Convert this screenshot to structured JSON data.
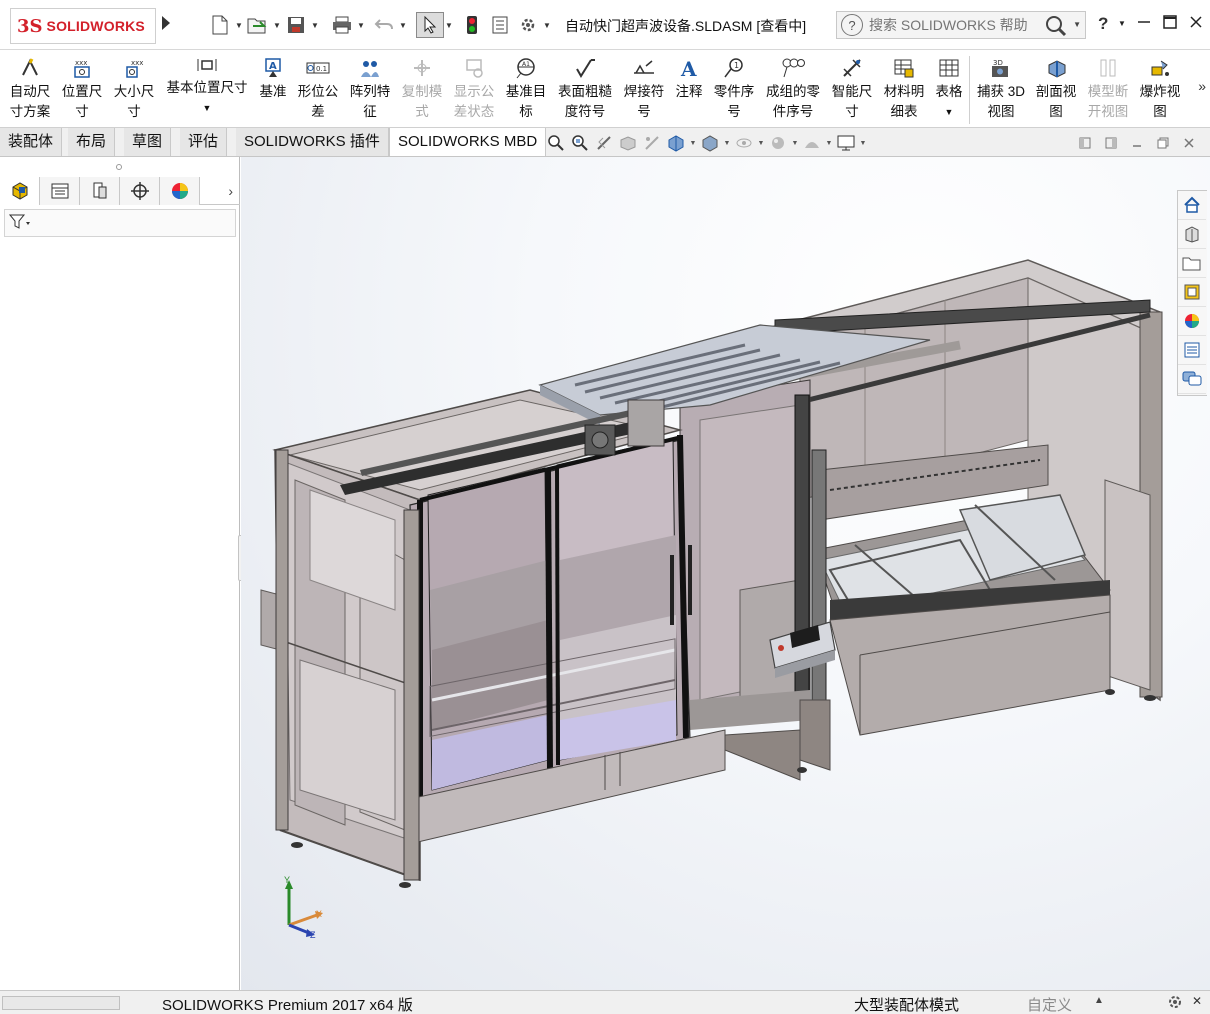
{
  "app": {
    "logo_ds": "3S",
    "logo_text": "SOLIDWORKS",
    "document_title": "自动快门超声波设备.SLDASM [查看中]"
  },
  "search": {
    "placeholder": "搜索 SOLIDWORKS 帮助",
    "help_label": "?"
  },
  "quick_access": [
    "new-icon",
    "open-icon",
    "save-icon",
    "print-icon",
    "undo-icon",
    "select-icon",
    "rebuild-icon",
    "file-properties-icon",
    "options-icon"
  ],
  "ribbon": {
    "items": [
      {
        "line1": "自动尺",
        "line2": "寸方案",
        "icon": "auto-dimension-icon",
        "enabled": true
      },
      {
        "line1": "位置尺",
        "line2": "寸",
        "icon": "location-dimension-icon",
        "enabled": true
      },
      {
        "line1": "大小尺",
        "line2": "寸",
        "icon": "size-dimension-icon",
        "enabled": true
      },
      {
        "line1": "基本位置尺寸",
        "line2": "",
        "icon": "basic-location-dimension-icon",
        "enabled": true
      },
      {
        "line1": "基准",
        "line2": "",
        "icon": "datum-icon",
        "enabled": true
      },
      {
        "line1": "形位公",
        "line2": "差",
        "icon": "geometric-tolerance-icon",
        "enabled": true
      },
      {
        "line1": "阵列特",
        "line2": "征",
        "icon": "pattern-feature-icon",
        "enabled": true
      },
      {
        "line1": "复制模",
        "line2": "式",
        "icon": "copy-scheme-icon",
        "enabled": false
      },
      {
        "line1": "显示公",
        "line2": "差状态",
        "icon": "show-tolerance-status-icon",
        "enabled": false
      },
      {
        "line1": "基准目",
        "line2": "标",
        "icon": "datum-target-icon",
        "enabled": true
      },
      {
        "line1": "表面粗糙",
        "line2": "度符号",
        "icon": "surface-finish-icon",
        "enabled": true
      },
      {
        "line1": "焊接符",
        "line2": "号",
        "icon": "weld-symbol-icon",
        "enabled": true
      },
      {
        "line1": "注释",
        "line2": "",
        "icon": "note-icon",
        "enabled": true
      },
      {
        "line1": "零件序",
        "line2": "号",
        "icon": "balloon-icon",
        "enabled": true
      },
      {
        "line1": "成组的零",
        "line2": "件序号",
        "icon": "stacked-balloon-icon",
        "enabled": true
      },
      {
        "line1": "智能尺",
        "line2": "寸",
        "icon": "smart-dimension-icon",
        "enabled": true
      },
      {
        "line1": "材料明",
        "line2": "细表",
        "icon": "bill-of-materials-icon",
        "enabled": true
      },
      {
        "line1": "表格",
        "line2": "",
        "icon": "table-icon",
        "enabled": true
      },
      {
        "line1": "捕获 3D",
        "line2": "视图",
        "icon": "capture-3d-view-icon",
        "enabled": true
      },
      {
        "line1": "剖面视",
        "line2": "图",
        "icon": "section-view-icon",
        "enabled": true
      },
      {
        "line1": "模型断",
        "line2": "开视图",
        "icon": "model-break-view-icon",
        "enabled": false
      },
      {
        "line1": "爆炸视",
        "line2": "图",
        "icon": "exploded-view-icon",
        "enabled": true
      }
    ],
    "more": "»"
  },
  "tabs": [
    "装配体",
    "布局",
    "草图",
    "评估",
    "SOLIDWORKS 插件",
    "SOLIDWORKS MBD"
  ],
  "active_tab": "SOLIDWORKS MBD",
  "left_panel": {
    "tabs": [
      "feature-manager-icon",
      "property-manager-icon",
      "configuration-manager-icon",
      "dimxpert-manager-icon",
      "display-manager-icon"
    ],
    "more": "›"
  },
  "triad": {
    "x": "X",
    "y": "Y",
    "z": "Z"
  },
  "task_pane": [
    "home-icon",
    "design-library-icon",
    "file-explorer-icon",
    "view-palette-icon",
    "appearances-icon",
    "custom-properties-icon",
    "forum-icon"
  ],
  "status": {
    "product": "SOLIDWORKS Premium 2017 x64 版",
    "mode": "大型装配体模式",
    "custom": "自定义"
  },
  "colors": {
    "brand": "#d3202a",
    "frame": "#8e8682",
    "panel_glass": "#b9aeb3",
    "accent_blue": "#1f5aa6"
  }
}
